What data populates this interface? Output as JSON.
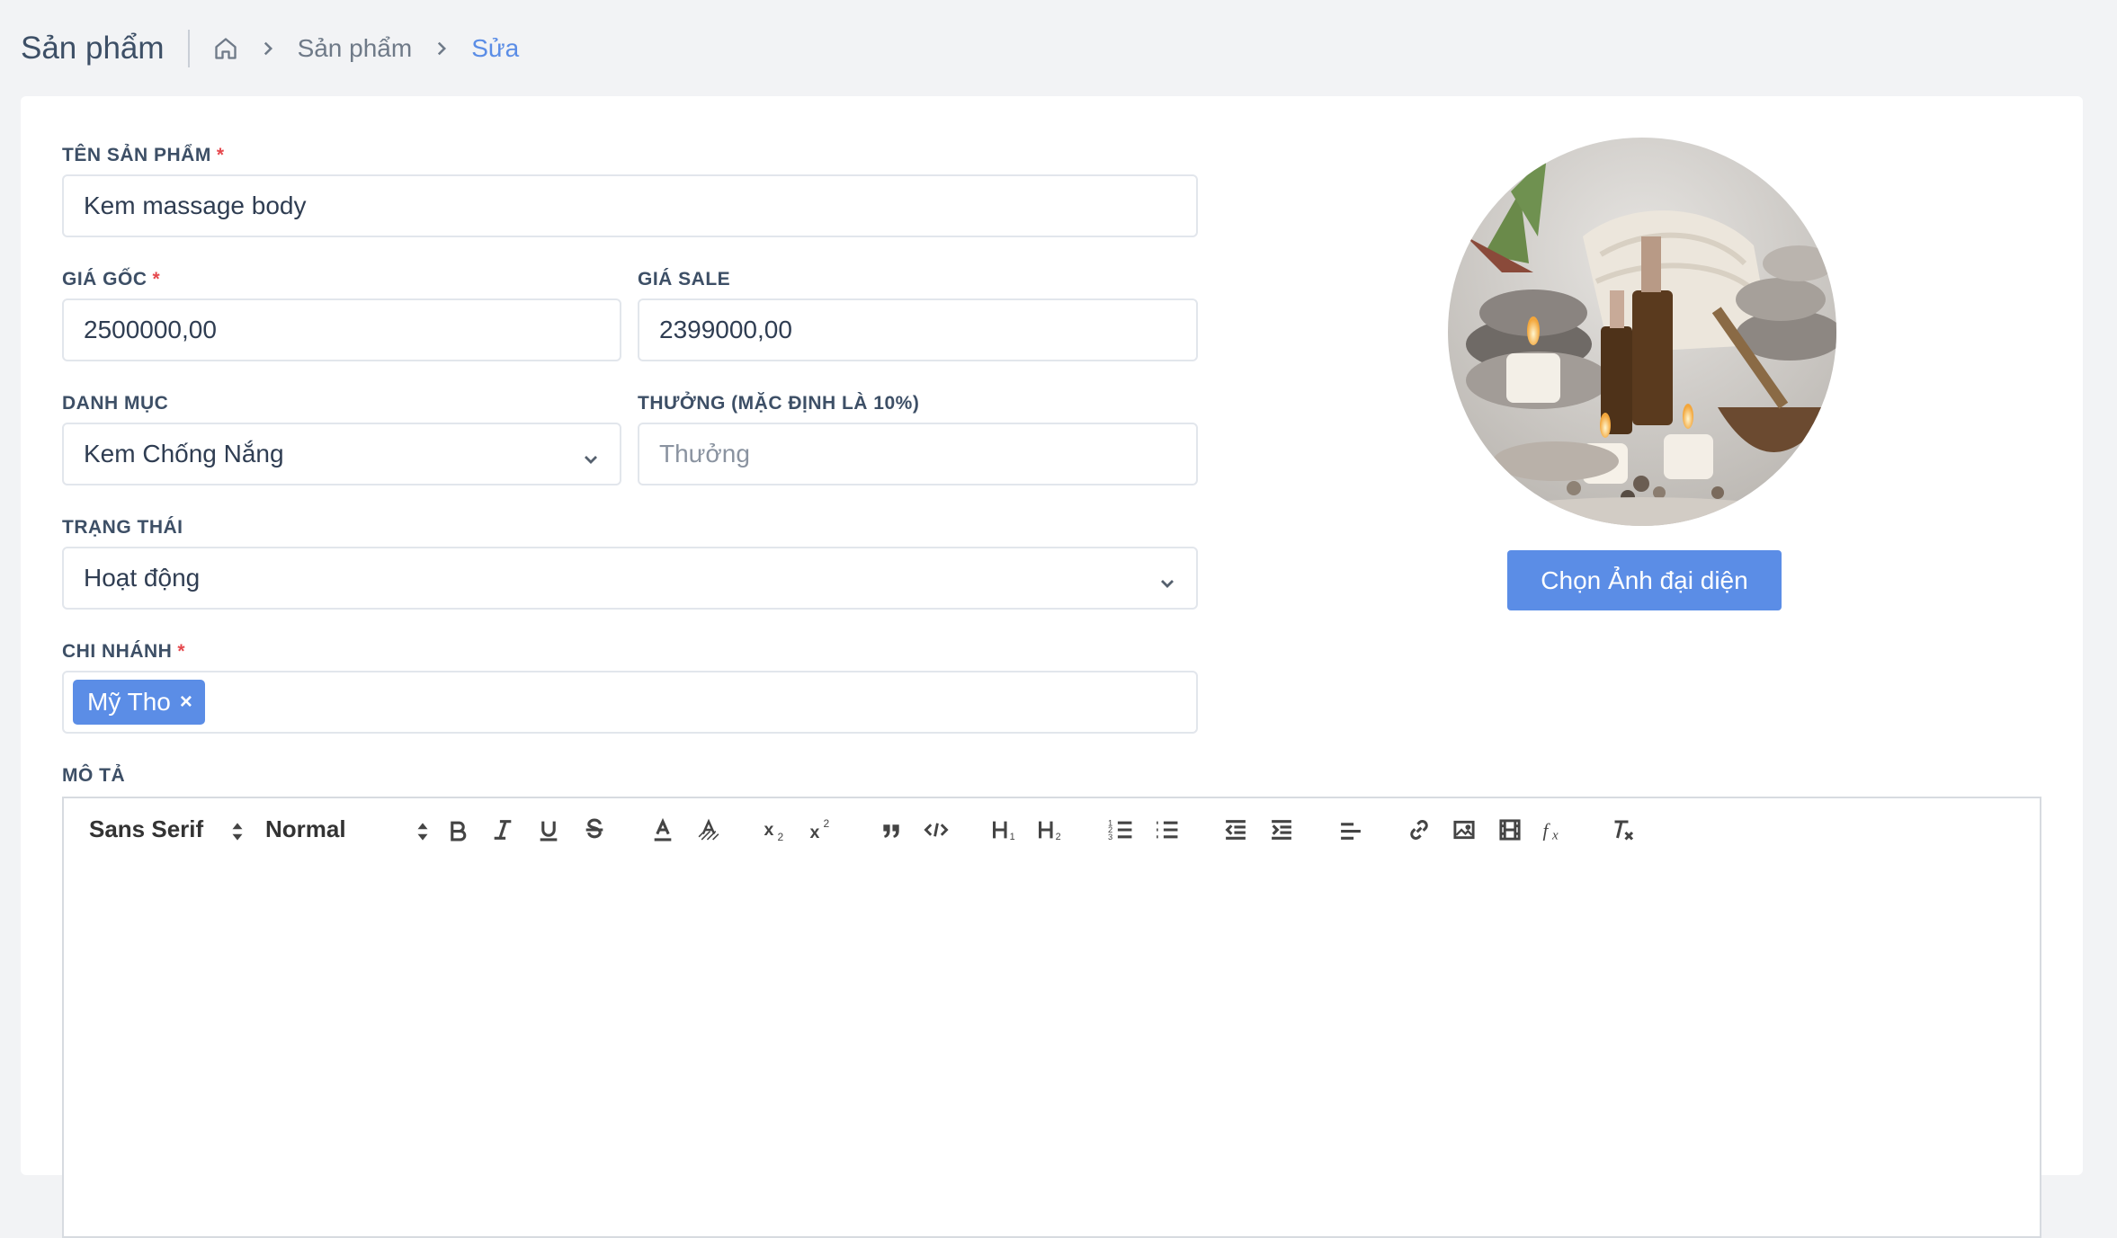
{
  "header": {
    "title": "Sản phẩm",
    "breadcrumb": [
      "Sản phẩm",
      "Sửa"
    ]
  },
  "form": {
    "name": {
      "label": "TÊN SẢN PHẨM",
      "required": "*",
      "value": "Kem massage body"
    },
    "price": {
      "label": "GIÁ GỐC",
      "required": "*",
      "value": "2500000,00"
    },
    "sale_price": {
      "label": "GIÁ SALE",
      "value": "2399000,00"
    },
    "category": {
      "label": "DANH MỤC",
      "value": "Kem Chống Nắng"
    },
    "bonus": {
      "label": "THƯỞNG (MẶC ĐỊNH LÀ 10%)",
      "placeholder": "Thưởng"
    },
    "status": {
      "label": "TRẠNG THÁI",
      "value": "Hoạt động"
    },
    "branch": {
      "label": "CHI NHÁNH",
      "required": "*",
      "tags": [
        "Mỹ Tho"
      ],
      "remove_glyph": "×"
    },
    "description": {
      "label": "MÔ TẢ"
    }
  },
  "avatar": {
    "button_label": "Chọn Ảnh đại diện"
  },
  "editor_toolbar": {
    "font": "Sans Serif",
    "size": "Normal",
    "icons": [
      "bold-icon",
      "italic-icon",
      "underline-icon",
      "strike-icon",
      "text-color-icon",
      "background-color-icon",
      "subscript-icon",
      "superscript-icon",
      "blockquote-icon",
      "code-block-icon",
      "header-1-icon",
      "header-2-icon",
      "ordered-list-icon",
      "bullet-list-icon",
      "outdent-icon",
      "indent-icon",
      "align-icon",
      "link-icon",
      "image-icon",
      "video-icon",
      "formula-icon",
      "clean-icon"
    ]
  },
  "colors": {
    "accent": "#5b8de6",
    "background": "#f2f3f5",
    "required": "#e5484d"
  }
}
